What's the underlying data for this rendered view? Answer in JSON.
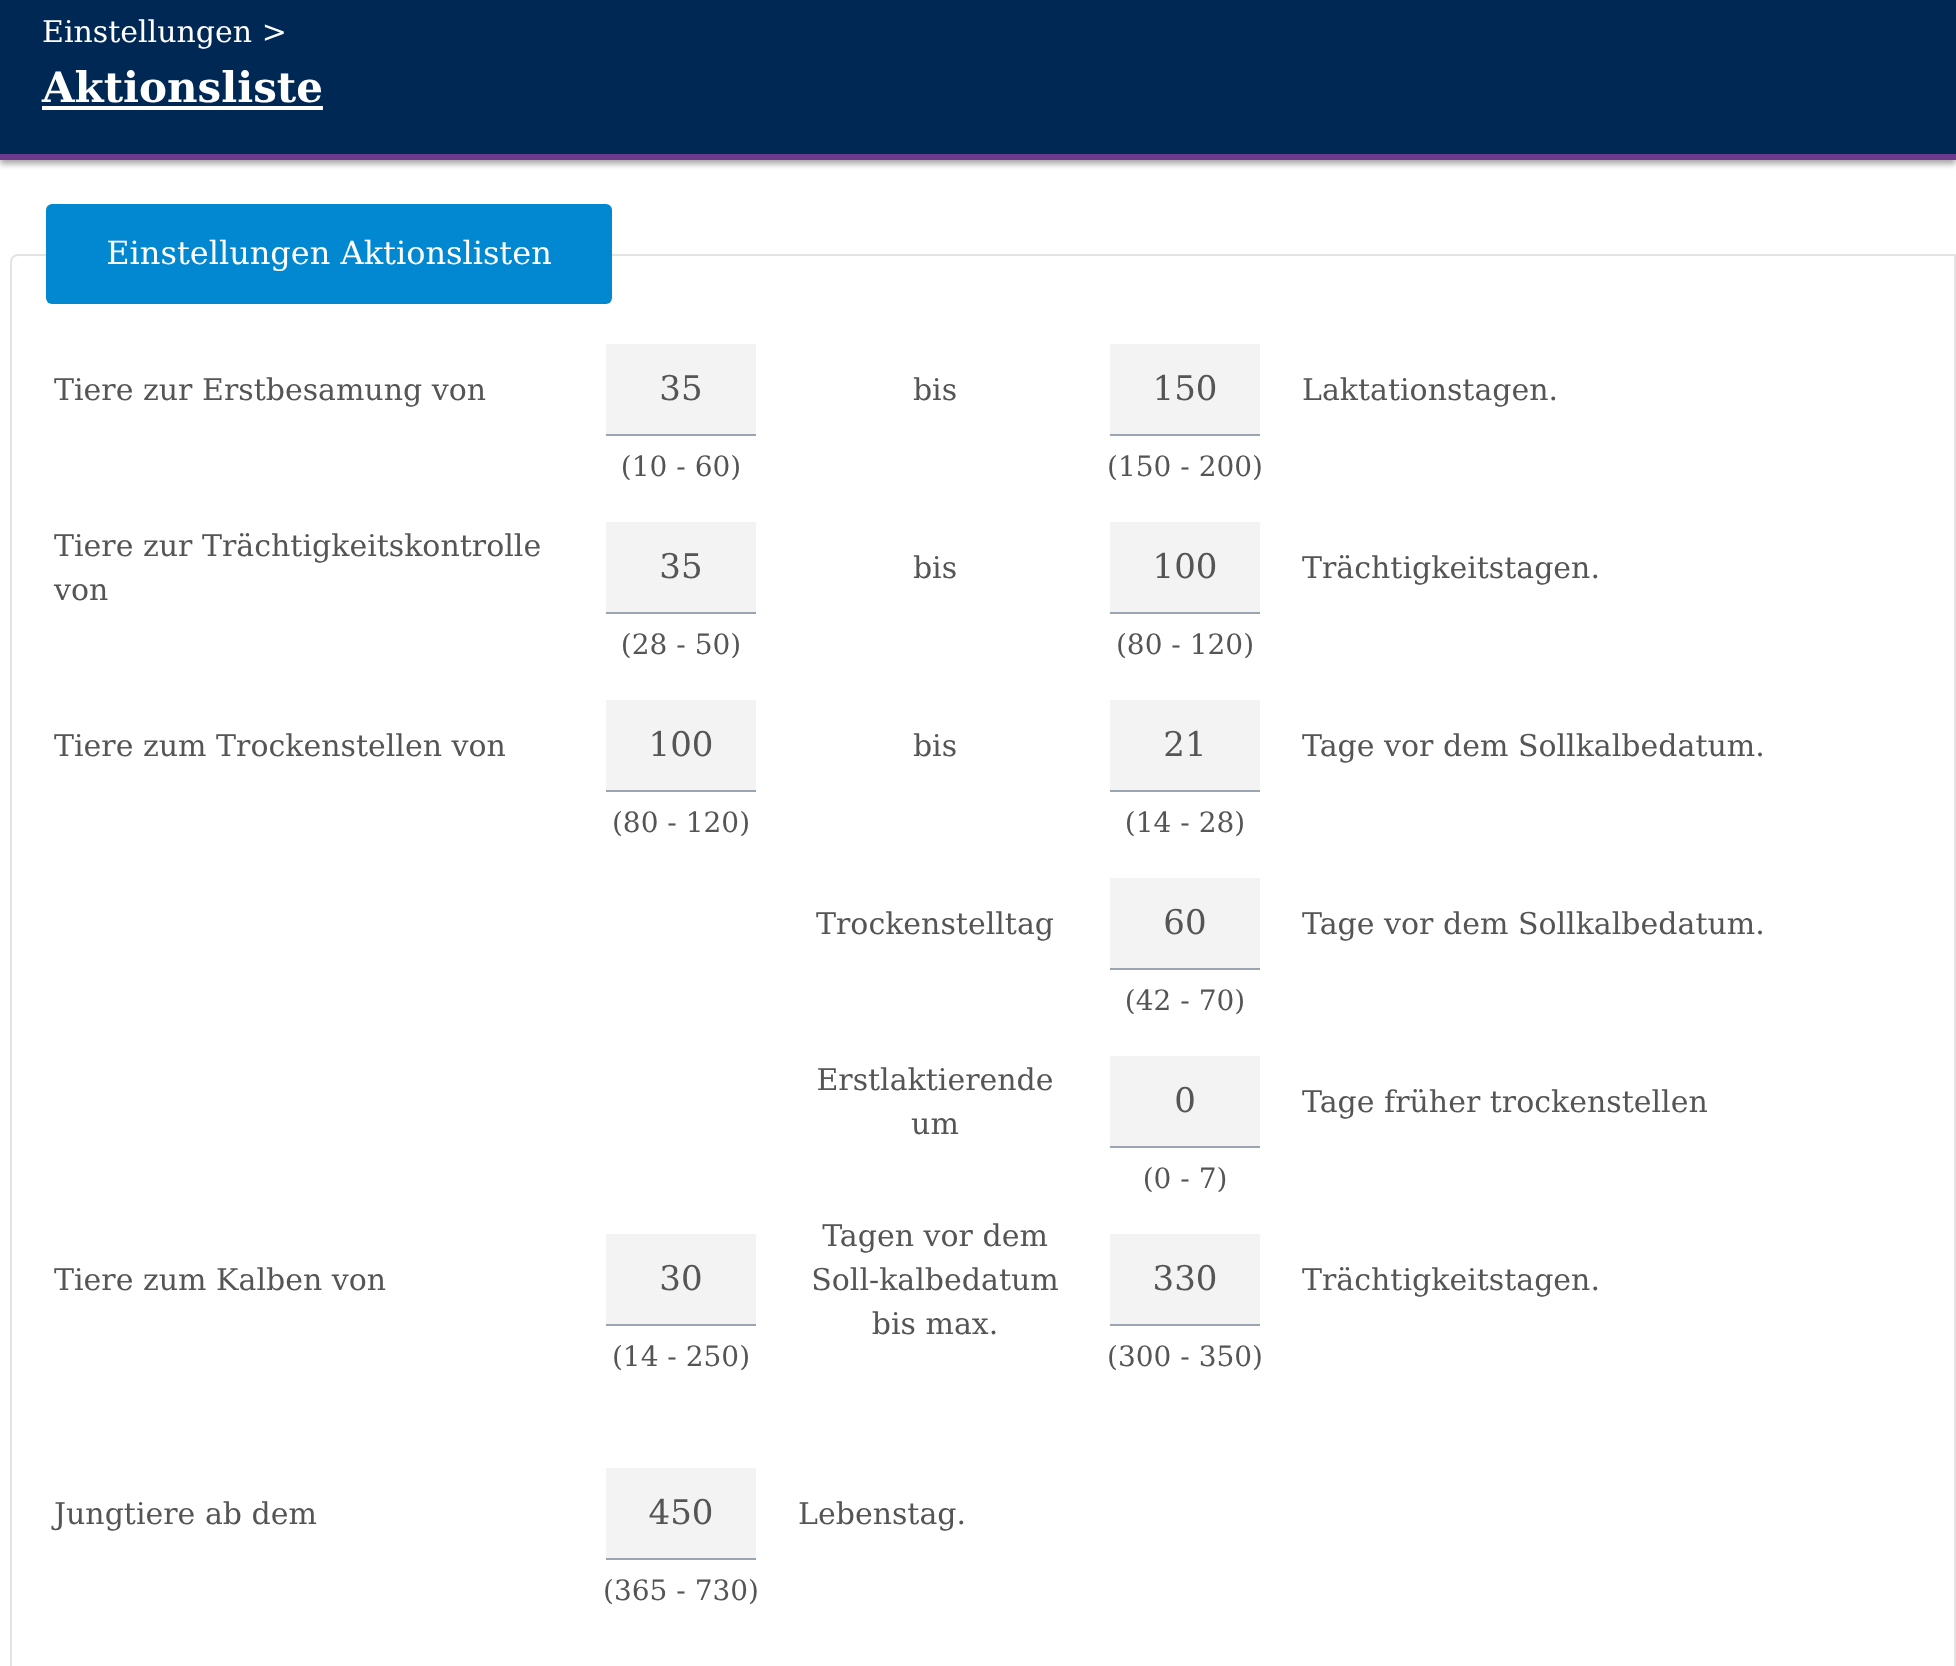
{
  "header": {
    "breadcrumb": "Einstellungen >",
    "title": "Aktionsliste"
  },
  "tab": {
    "label": "Einstellungen Aktionslisten"
  },
  "rows": [
    {
      "label": "Tiere zur Erstbesamung von",
      "from": {
        "value": "35",
        "range": "(10 - 60)"
      },
      "middle": "bis",
      "to": {
        "value": "150",
        "range": "(150 - 200)"
      },
      "suffix": "Laktationstagen."
    },
    {
      "label": "Tiere zur Trächtigkeitskontrolle von",
      "from": {
        "value": "35",
        "range": "(28 - 50)"
      },
      "middle": "bis",
      "to": {
        "value": "100",
        "range": "(80 - 120)"
      },
      "suffix": "Trächtigkeitstagen."
    },
    {
      "label": "Tiere zum Trockenstellen von",
      "from": {
        "value": "100",
        "range": "(80 - 120)"
      },
      "middle": "bis",
      "to": {
        "value": "21",
        "range": "(14 - 28)"
      },
      "suffix": "Tage vor dem Sollkalbedatum."
    },
    {
      "middle": "Trockenstelltag",
      "to": {
        "value": "60",
        "range": "(42 - 70)"
      },
      "suffix": "Tage vor dem Sollkalbedatum."
    },
    {
      "middle": "Erstlaktierende um",
      "to": {
        "value": "0",
        "range": "(0 - 7)"
      },
      "suffix": "Tage früher trockenstellen"
    },
    {
      "label": "Tiere zum Kalben von",
      "from": {
        "value": "30",
        "range": "(14 - 250)"
      },
      "middle": "Tagen vor dem Soll-kalbedatum bis max.",
      "to": {
        "value": "330",
        "range": "(300 - 350)"
      },
      "suffix": "Trächtigkeitstagen."
    },
    {
      "label": "Jungtiere ab dem",
      "from": {
        "value": "450",
        "range": "(365 - 730)"
      },
      "suffix": "Lebenstag."
    }
  ]
}
